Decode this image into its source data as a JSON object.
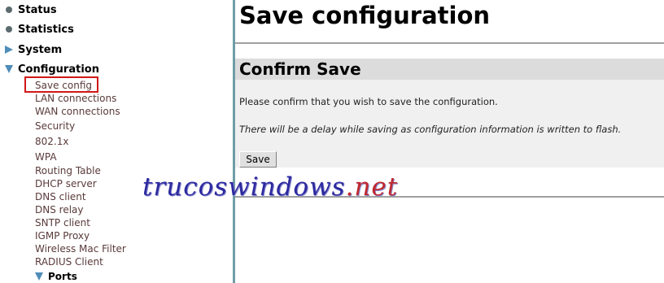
{
  "sidebar": {
    "sections": [
      {
        "label": "Status",
        "icon": "dot-icon"
      },
      {
        "label": "Statistics",
        "icon": "dot-icon"
      },
      {
        "label": "System",
        "icon": "triangle-right-icon"
      },
      {
        "label": "Configuration",
        "icon": "triangle-down-icon"
      }
    ],
    "config_items": [
      "Save config",
      "LAN connections",
      "WAN connections",
      "Security",
      "802.1x",
      "WPA",
      "Routing Table",
      "DHCP server",
      "DNS client",
      "DNS relay",
      "SNTP client",
      "IGMP Proxy",
      "Wireless Mac Filter",
      "RADIUS Client"
    ],
    "ports_label": "Ports",
    "highlight_color": "#d01818"
  },
  "main": {
    "page_title": "Save configuration",
    "section_title": "Confirm Save",
    "confirm_text": "Please confirm that you wish to save the configuration.",
    "delay_text": "There will be a delay while saving as configuration information is written to flash.",
    "save_button": "Save"
  },
  "watermark": {
    "main": "trucoswindows",
    "accent": ".net"
  }
}
